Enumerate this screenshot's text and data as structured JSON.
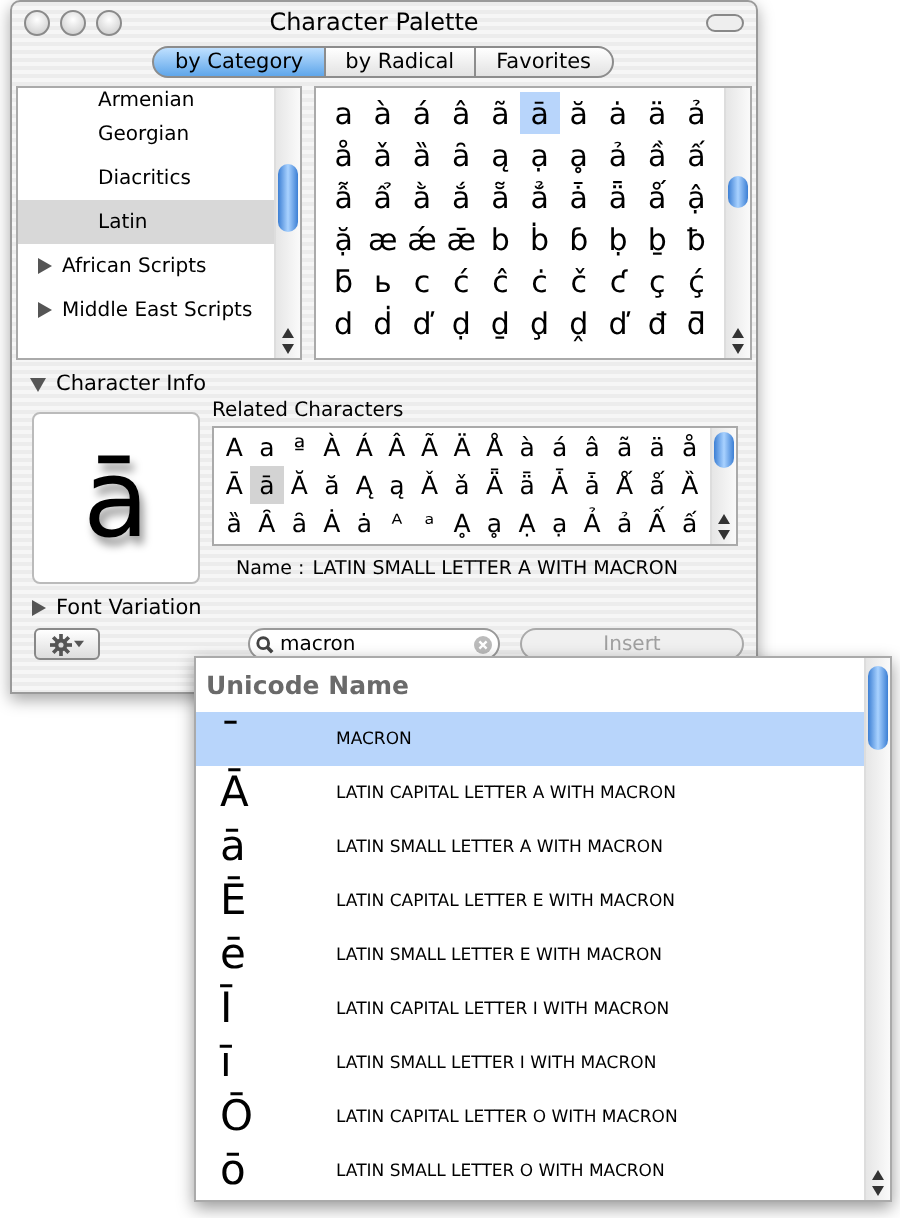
{
  "window": {
    "title": "Character Palette"
  },
  "tabs": [
    {
      "label": "by Category",
      "selected": true
    },
    {
      "label": "by Radical",
      "selected": false
    },
    {
      "label": "Favorites",
      "selected": false
    }
  ],
  "categories": [
    {
      "label": "Armenian",
      "kind": "item",
      "selected": false
    },
    {
      "label": "Georgian",
      "kind": "item",
      "selected": false
    },
    {
      "label": "Diacritics",
      "kind": "item",
      "selected": false
    },
    {
      "label": "Latin",
      "kind": "item",
      "selected": true
    },
    {
      "label": "African Scripts",
      "kind": "group",
      "expanded": false,
      "selected": false
    },
    {
      "label": "Middle East Scripts",
      "kind": "group",
      "expanded": false,
      "selected": false
    }
  ],
  "glyphs": [
    [
      {
        "char": "a",
        "selected": false
      },
      {
        "char": "à",
        "selected": false
      },
      {
        "char": "á",
        "selected": false
      },
      {
        "char": "â",
        "selected": false
      },
      {
        "char": "ã",
        "selected": false
      },
      {
        "char": "ā",
        "selected": true
      },
      {
        "char": "ă",
        "selected": false
      },
      {
        "char": "ȧ",
        "selected": false
      },
      {
        "char": "ä",
        "selected": false
      },
      {
        "char": "ả",
        "selected": false
      }
    ],
    [
      {
        "char": "å",
        "selected": false
      },
      {
        "char": "ǎ",
        "selected": false
      },
      {
        "char": "ȁ",
        "selected": false
      },
      {
        "char": "ȃ",
        "selected": false
      },
      {
        "char": "ą",
        "selected": false
      },
      {
        "char": "ạ",
        "selected": false
      },
      {
        "char": "ḁ",
        "selected": false
      },
      {
        "char": "ả",
        "selected": false
      },
      {
        "char": "ầ",
        "selected": false
      },
      {
        "char": "ấ",
        "selected": false
      }
    ],
    [
      {
        "char": "ẫ",
        "selected": false
      },
      {
        "char": "ẩ",
        "selected": false
      },
      {
        "char": "ằ",
        "selected": false
      },
      {
        "char": "ắ",
        "selected": false
      },
      {
        "char": "ẵ",
        "selected": false
      },
      {
        "char": "ẳ",
        "selected": false
      },
      {
        "char": "ǡ",
        "selected": false
      },
      {
        "char": "ǟ",
        "selected": false
      },
      {
        "char": "ǻ",
        "selected": false
      },
      {
        "char": "ậ",
        "selected": false
      }
    ],
    [
      {
        "char": "ặ",
        "selected": false
      },
      {
        "char": "æ",
        "selected": false
      },
      {
        "char": "ǽ",
        "selected": false
      },
      {
        "char": "ǣ",
        "selected": false
      },
      {
        "char": "b",
        "selected": false
      },
      {
        "char": "ḃ",
        "selected": false
      },
      {
        "char": "ɓ",
        "selected": false
      },
      {
        "char": "ḅ",
        "selected": false
      },
      {
        "char": "ḇ",
        "selected": false
      },
      {
        "char": "ƀ",
        "selected": false
      }
    ],
    [
      {
        "char": "ƃ",
        "selected": false
      },
      {
        "char": "ь",
        "selected": false
      },
      {
        "char": "c",
        "selected": false
      },
      {
        "char": "ć",
        "selected": false
      },
      {
        "char": "ĉ",
        "selected": false
      },
      {
        "char": "ċ",
        "selected": false
      },
      {
        "char": "č",
        "selected": false
      },
      {
        "char": "ƈ",
        "selected": false
      },
      {
        "char": "ç",
        "selected": false
      },
      {
        "char": "ḉ",
        "selected": false
      }
    ],
    [
      {
        "char": "d",
        "selected": false
      },
      {
        "char": "ḋ",
        "selected": false
      },
      {
        "char": "ď",
        "selected": false
      },
      {
        "char": "ḍ",
        "selected": false
      },
      {
        "char": "ḏ",
        "selected": false
      },
      {
        "char": "ḑ",
        "selected": false
      },
      {
        "char": "ḓ",
        "selected": false
      },
      {
        "char": "ď",
        "selected": false
      },
      {
        "char": "đ",
        "selected": false
      },
      {
        "char": "ƌ",
        "selected": false
      }
    ]
  ],
  "character_info": {
    "label": "Character Info",
    "expanded": true,
    "preview": "ā",
    "related_label": "Related Characters",
    "related": [
      [
        {
          "char": "A",
          "selected": false
        },
        {
          "char": "a",
          "selected": false
        },
        {
          "char": "ª",
          "selected": false
        },
        {
          "char": "À",
          "selected": false
        },
        {
          "char": "Á",
          "selected": false
        },
        {
          "char": "Â",
          "selected": false
        },
        {
          "char": "Ã",
          "selected": false
        },
        {
          "char": "Ä",
          "selected": false
        },
        {
          "char": "Å",
          "selected": false
        },
        {
          "char": "à",
          "selected": false
        },
        {
          "char": "á",
          "selected": false
        },
        {
          "char": "â",
          "selected": false
        },
        {
          "char": "ã",
          "selected": false
        },
        {
          "char": "ä",
          "selected": false
        },
        {
          "char": "å",
          "selected": false
        }
      ],
      [
        {
          "char": "Ā",
          "selected": false
        },
        {
          "char": "ā",
          "selected": true
        },
        {
          "char": "Ă",
          "selected": false
        },
        {
          "char": "ă",
          "selected": false
        },
        {
          "char": "Ą",
          "selected": false
        },
        {
          "char": "ą",
          "selected": false
        },
        {
          "char": "Ǎ",
          "selected": false
        },
        {
          "char": "ǎ",
          "selected": false
        },
        {
          "char": "Ǟ",
          "selected": false
        },
        {
          "char": "ǟ",
          "selected": false
        },
        {
          "char": "Ǡ",
          "selected": false
        },
        {
          "char": "ǡ",
          "selected": false
        },
        {
          "char": "Ǻ",
          "selected": false
        },
        {
          "char": "ǻ",
          "selected": false
        },
        {
          "char": "Ȁ",
          "selected": false
        }
      ],
      [
        {
          "char": "ȁ",
          "selected": false
        },
        {
          "char": "Ȃ",
          "selected": false
        },
        {
          "char": "ȃ",
          "selected": false
        },
        {
          "char": "Ȧ",
          "selected": false
        },
        {
          "char": "ȧ",
          "selected": false
        },
        {
          "char": "ᴬ",
          "selected": false
        },
        {
          "char": "ᵃ",
          "selected": false
        },
        {
          "char": "Ḁ",
          "selected": false
        },
        {
          "char": "ḁ",
          "selected": false
        },
        {
          "char": "Ạ",
          "selected": false
        },
        {
          "char": "ạ",
          "selected": false
        },
        {
          "char": "Ả",
          "selected": false
        },
        {
          "char": "ả",
          "selected": false
        },
        {
          "char": "Ấ",
          "selected": false
        },
        {
          "char": "ấ",
          "selected": false
        }
      ]
    ],
    "name_label": "Name :",
    "name": "LATIN SMALL LETTER A WITH MACRON"
  },
  "font_variation": {
    "label": "Font Variation",
    "expanded": false
  },
  "search": {
    "value": "macron"
  },
  "insert_button": {
    "label": "Insert",
    "disabled": true
  },
  "results": {
    "header": "Unicode Name",
    "rows": [
      {
        "char": "¯",
        "name": "MACRON",
        "selected": true
      },
      {
        "char": "Ā",
        "name": "LATIN CAPITAL LETTER A WITH MACRON",
        "selected": false
      },
      {
        "char": "ā",
        "name": "LATIN SMALL LETTER A WITH MACRON",
        "selected": false
      },
      {
        "char": "Ē",
        "name": "LATIN CAPITAL LETTER E WITH MACRON",
        "selected": false
      },
      {
        "char": "ē",
        "name": "LATIN SMALL LETTER E WITH MACRON",
        "selected": false
      },
      {
        "char": "Ī",
        "name": "LATIN CAPITAL LETTER I WITH MACRON",
        "selected": false
      },
      {
        "char": "ī",
        "name": "LATIN SMALL LETTER I WITH MACRON",
        "selected": false
      },
      {
        "char": "Ō",
        "name": "LATIN CAPITAL LETTER O WITH MACRON",
        "selected": false
      },
      {
        "char": "ō",
        "name": "LATIN SMALL LETTER O WITH MACRON",
        "selected": false
      }
    ]
  }
}
